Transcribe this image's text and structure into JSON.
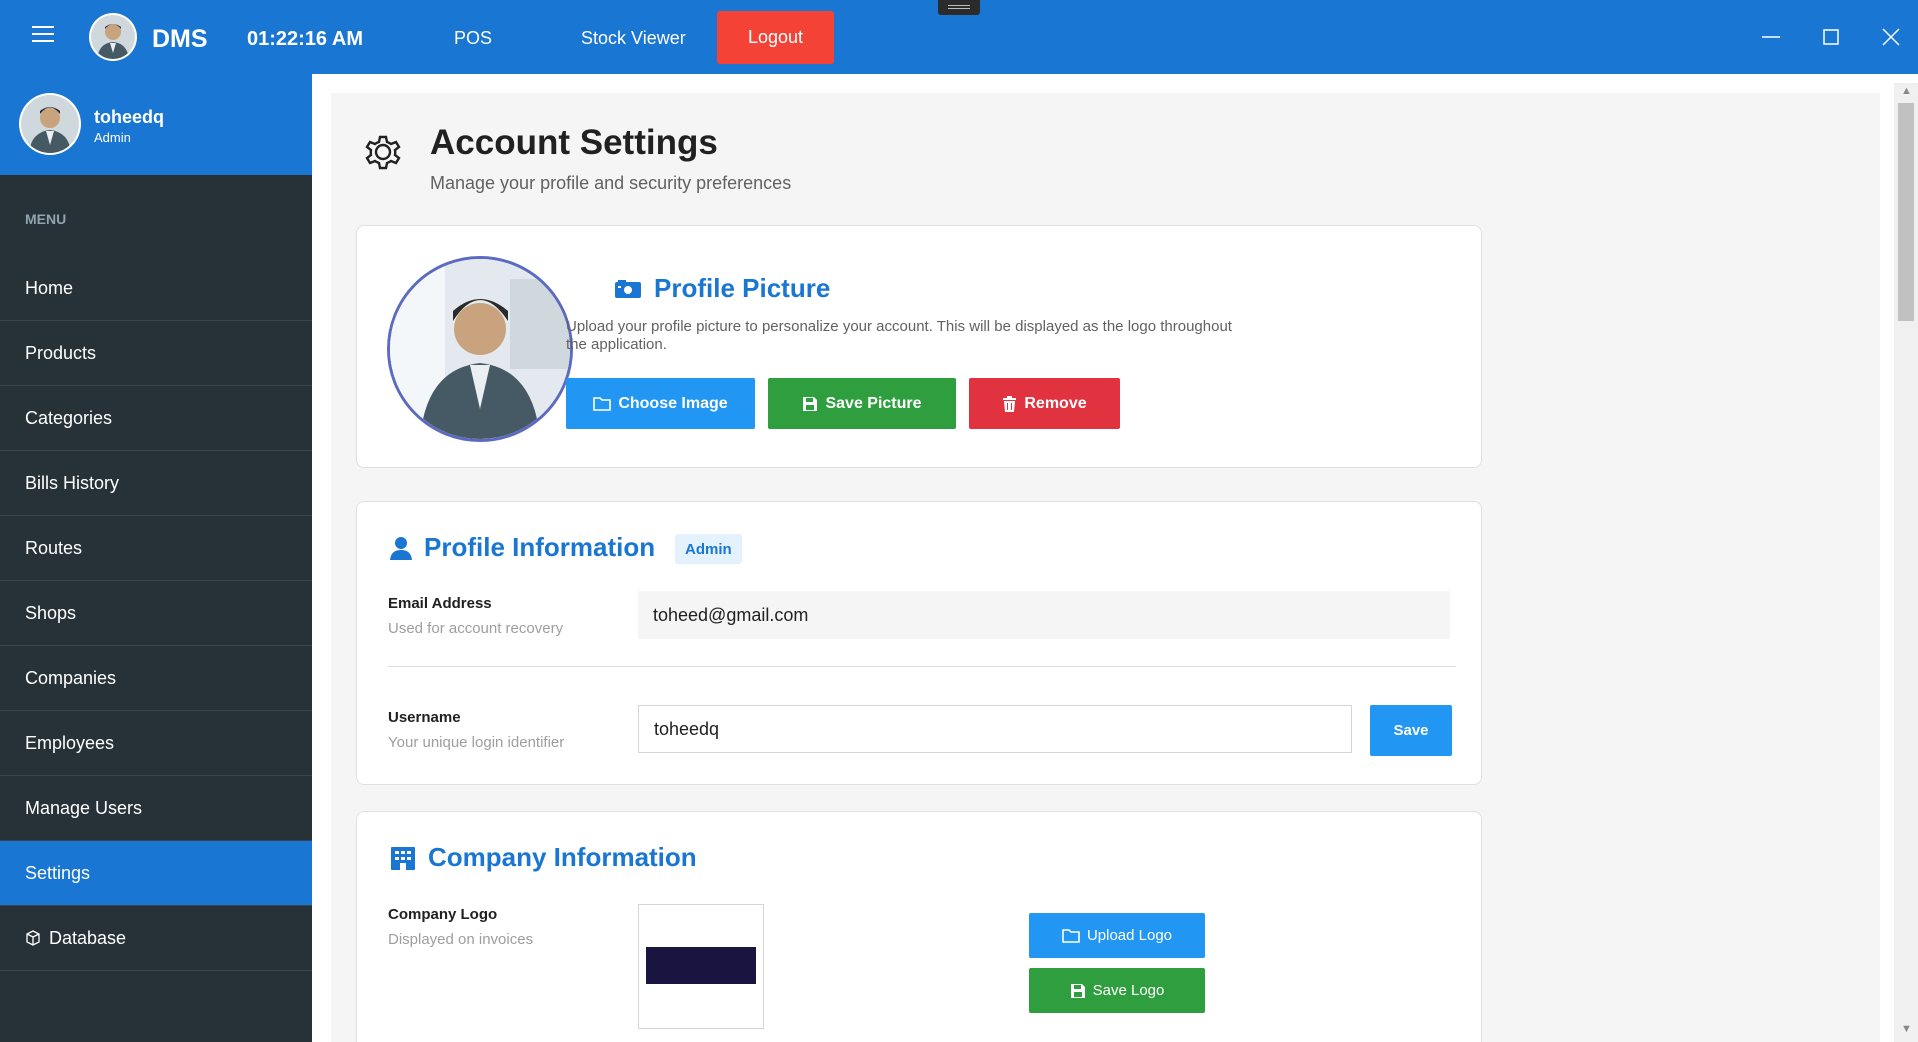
{
  "topbar": {
    "app_name": "DMS",
    "time": "01:22:16 AM",
    "nav_pos": "POS",
    "nav_stock_viewer": "Stock Viewer",
    "logout": "Logout"
  },
  "sidebar": {
    "username": "toheedq",
    "role": "Admin",
    "menu_title": "MENU",
    "items": [
      {
        "label": "Home"
      },
      {
        "label": "Products"
      },
      {
        "label": "Categories"
      },
      {
        "label": "Bills History"
      },
      {
        "label": "Routes"
      },
      {
        "label": "Shops"
      },
      {
        "label": "Companies"
      },
      {
        "label": "Employees"
      },
      {
        "label": "Manage Users"
      },
      {
        "label": "Settings",
        "active": true
      },
      {
        "label": "Database",
        "icon": "cube-icon"
      }
    ]
  },
  "page": {
    "title": "Account Settings",
    "subtitle": "Manage your profile and security preferences"
  },
  "profile_picture": {
    "title": "Profile Picture",
    "description": "Upload your profile picture to personalize your account. This will be displayed as the logo throughout the application.",
    "choose_image": "Choose Image",
    "save_picture": "Save Picture",
    "remove": "Remove"
  },
  "profile_info": {
    "title": "Profile Information",
    "badge": "Admin",
    "email_label": "Email Address",
    "email_sub": "Used for account recovery",
    "email_value": "toheed@gmail.com",
    "username_label": "Username",
    "username_sub": "Your unique login identifier",
    "username_value": "toheedq",
    "save": "Save"
  },
  "company_info": {
    "title": "Company Information",
    "logo_label": "Company Logo",
    "logo_sub": "Displayed on invoices",
    "upload_logo": "Upload Logo",
    "save_logo": "Save Logo"
  },
  "colors": {
    "primary": "#1976d2",
    "sidebar_bg": "#263238",
    "logout": "#f44336",
    "button_blue": "#2196f3",
    "button_green": "#2e9e3e",
    "button_red": "#e0323f"
  }
}
